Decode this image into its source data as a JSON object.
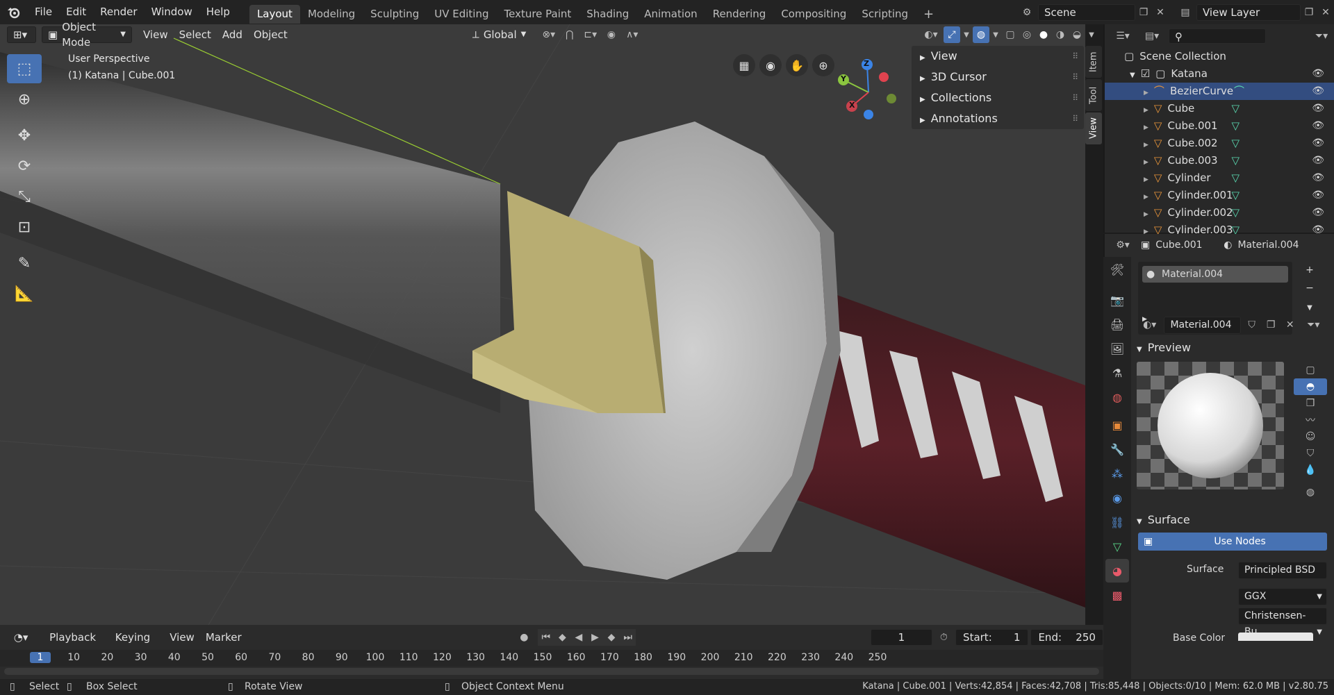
{
  "topbar": {
    "menus": [
      "File",
      "Edit",
      "Render",
      "Window",
      "Help"
    ],
    "workspaces": [
      "Layout",
      "Modeling",
      "Sculpting",
      "UV Editing",
      "Texture Paint",
      "Shading",
      "Animation",
      "Rendering",
      "Compositing",
      "Scripting"
    ],
    "active_workspace": "Layout",
    "add_tab": "+",
    "scene": "Scene",
    "view_layer": "View Layer"
  },
  "viewport": {
    "mode": "Object Mode",
    "menus": [
      "View",
      "Select",
      "Add",
      "Object"
    ],
    "transform_orientation": "Global",
    "perspective_label": "User Perspective",
    "object_label": "(1) Katana | Cube.001",
    "gizmo": {
      "x": "X",
      "y": "Y",
      "z": "Z"
    }
  },
  "npanel": {
    "rows": [
      "View",
      "3D Cursor",
      "Collections",
      "Annotations"
    ],
    "tabs": [
      "Item",
      "Tool",
      "View"
    ],
    "active_tab": "View"
  },
  "outliner": {
    "root": "Scene Collection",
    "collection": "Katana",
    "items": [
      {
        "name": "BezierCurve",
        "type": "curve"
      },
      {
        "name": "Cube",
        "type": "mesh"
      },
      {
        "name": "Cube.001",
        "type": "mesh"
      },
      {
        "name": "Cube.002",
        "type": "mesh"
      },
      {
        "name": "Cube.003",
        "type": "mesh"
      },
      {
        "name": "Cylinder",
        "type": "mesh"
      },
      {
        "name": "Cylinder.001",
        "type": "mesh"
      },
      {
        "name": "Cylinder.002",
        "type": "mesh"
      },
      {
        "name": "Cylinder.003",
        "type": "mesh"
      }
    ],
    "selected": "BezierCurve"
  },
  "properties": {
    "object": "Cube.001",
    "material_tab": "Material.004",
    "slot": "Material.004",
    "material_name": "Material.004",
    "preview_label": "Preview",
    "surface_section": "Surface",
    "use_nodes": "Use Nodes",
    "surface_label": "Surface",
    "surface_value": "Principled BSD",
    "distribution": "GGX",
    "subsurface": "Christensen-Bu...",
    "base_color_label": "Base Color"
  },
  "timeline": {
    "menus": [
      "Playback",
      "Keying",
      "View",
      "Marker"
    ],
    "current_frame": "1",
    "start_label": "Start:",
    "start": "1",
    "end_label": "End:",
    "end": "250",
    "ticks": [
      "1",
      "10",
      "20",
      "30",
      "40",
      "50",
      "60",
      "70",
      "80",
      "90",
      "100",
      "110",
      "120",
      "130",
      "140",
      "150",
      "160",
      "170",
      "180",
      "190",
      "200",
      "210",
      "220",
      "230",
      "240",
      "250"
    ]
  },
  "statusbar": {
    "select": "Select",
    "box_select": "Box Select",
    "rotate_view": "Rotate View",
    "context_menu": "Object Context Menu",
    "stats": "Katana | Cube.001 | Verts:42,854 | Faces:42,708 | Tris:85,448 | Objects:0/10 | Mem: 62.0 MB | v2.80.75"
  },
  "colors": {
    "accent": "#4772b3",
    "selected_row": "#334d80",
    "handle_wrap": "#5a1f26",
    "guard_gold": "#b8ad72",
    "axis_x": "#e0434f",
    "axis_y": "#8bc53f",
    "axis_z": "#3b84e6"
  }
}
